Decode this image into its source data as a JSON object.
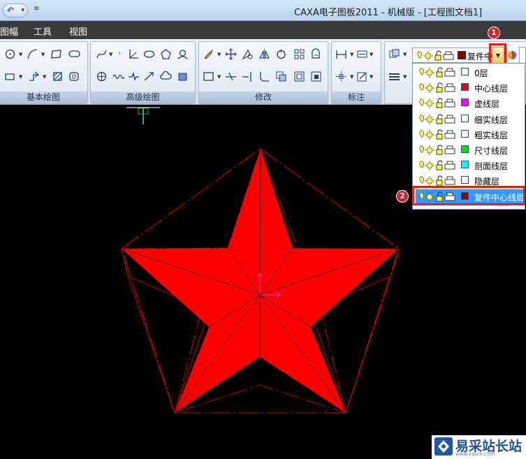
{
  "window": {
    "title": "CAXA电子图板2011 - 机械版 - [工程图文档1]"
  },
  "menu": {
    "items": [
      "图幅",
      "工具",
      "视图"
    ]
  },
  "ribbon": {
    "groups": [
      {
        "label": "基本绘图"
      },
      {
        "label": "高级绘图"
      },
      {
        "label": "修改"
      },
      {
        "label": "标注"
      }
    ]
  },
  "layer_combo": {
    "current": "复件中"
  },
  "layers": [
    {
      "name": "0层",
      "color": "#ffffff"
    },
    {
      "name": "中心线层",
      "color": "#e0001a"
    },
    {
      "name": "虚线层",
      "color": "#ff00ff"
    },
    {
      "name": "细实线层",
      "color": "#ffffff"
    },
    {
      "name": "粗实线层",
      "color": "#ffffff"
    },
    {
      "name": "尺寸线层",
      "color": "#00e000"
    },
    {
      "name": "剖面线层",
      "color": "#00ffff"
    },
    {
      "name": "隐藏层",
      "color": "#ffffff"
    },
    {
      "name": "复件中心线层",
      "color": "#8b0000"
    }
  ],
  "callouts": {
    "step1": "1",
    "step2": "2"
  },
  "colors": {
    "star": "#ff0000",
    "dash": "#e60000",
    "canvas": "#000000",
    "selection": "#3399ff"
  },
  "watermark": {
    "title": "易采站长站",
    "subtitle": "www.easck.com"
  }
}
